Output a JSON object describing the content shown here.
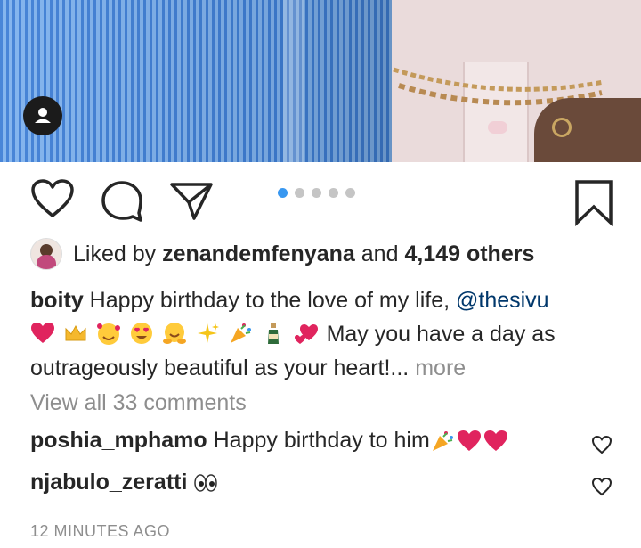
{
  "post": {
    "likes": {
      "prefix": "Liked by",
      "user": "zenandemfenyana",
      "and": "and",
      "count": "4,149 others"
    },
    "caption": {
      "username": "boity",
      "text": "Happy birthday to the love of my life,",
      "mention": "@thesivu",
      "text2": "May you have a day as outrageously beautiful as your heart!...",
      "more": "more"
    },
    "view_all": "View all 33 comments",
    "comments": [
      {
        "username": "poshia_mphamo",
        "text": "Happy birthday to him"
      },
      {
        "username": "njabulo_zeratti",
        "text": ""
      }
    ],
    "timestamp": "12 MINUTES AGO",
    "carousel": {
      "count": 5,
      "active_index": 0
    }
  },
  "icons": [
    "user-tag-icon",
    "heart-icon",
    "comment-icon",
    "share-icon",
    "bookmark-icon"
  ],
  "colors": {
    "accent": "#3897f0",
    "mention": "#00376b",
    "muted": "#8e8e8e",
    "heart_red": "#e0245e"
  }
}
